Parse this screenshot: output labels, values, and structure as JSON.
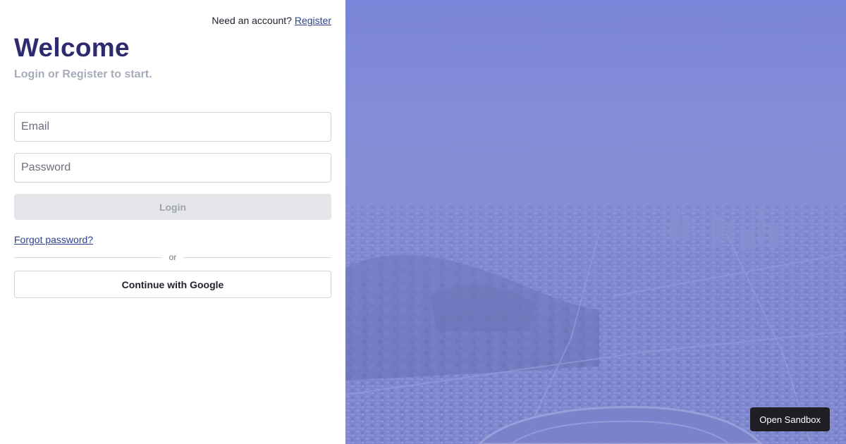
{
  "header": {
    "prompt_text": "Need an account?",
    "register_link": "Register"
  },
  "hero": {
    "title": "Welcome",
    "subtitle": "Login or Register to start."
  },
  "form": {
    "email_placeholder": "Email",
    "email_value": "",
    "password_placeholder": "Password",
    "password_value": "",
    "login_label": "Login",
    "forgot_link": "Forgot password?",
    "divider_text": "or",
    "google_label": "Continue with Google"
  },
  "background": {
    "image": "city-aerial-photo",
    "overlay_color": "#7a84d8"
  },
  "sandbox": {
    "label": "Open Sandbox"
  }
}
